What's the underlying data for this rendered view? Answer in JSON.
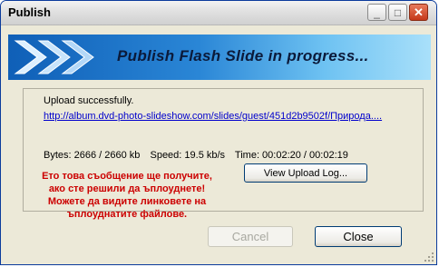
{
  "window": {
    "title": "Publish",
    "minimize_glyph": "_",
    "maximize_glyph": "□",
    "close_glyph": "✕"
  },
  "banner": {
    "text": "Publish Flash Slide in progress..."
  },
  "status": {
    "message": "Upload successfully.",
    "link": "http://album.dvd-photo-slideshow.com/slides/guest/451d2b9502f/Природа....",
    "bytes": "Bytes: 2666 / 2660 kb",
    "speed": "Speed: 19.5 kb/s",
    "time": "Time: 00:02:20 / 00:02:19"
  },
  "note": {
    "line1": "Ето това съобщение ще получите,",
    "line2": "ако сте решили да ъплоуднете!",
    "line3": "Можете да видите линковете на",
    "line4": "ъплоуднатите файлове."
  },
  "buttons": {
    "view_log": "View Upload Log...",
    "cancel": "Cancel",
    "close": "Close"
  },
  "colors": {
    "accent": "#0b3b9c",
    "note_text": "#cc0000",
    "link": "#0000cc"
  }
}
